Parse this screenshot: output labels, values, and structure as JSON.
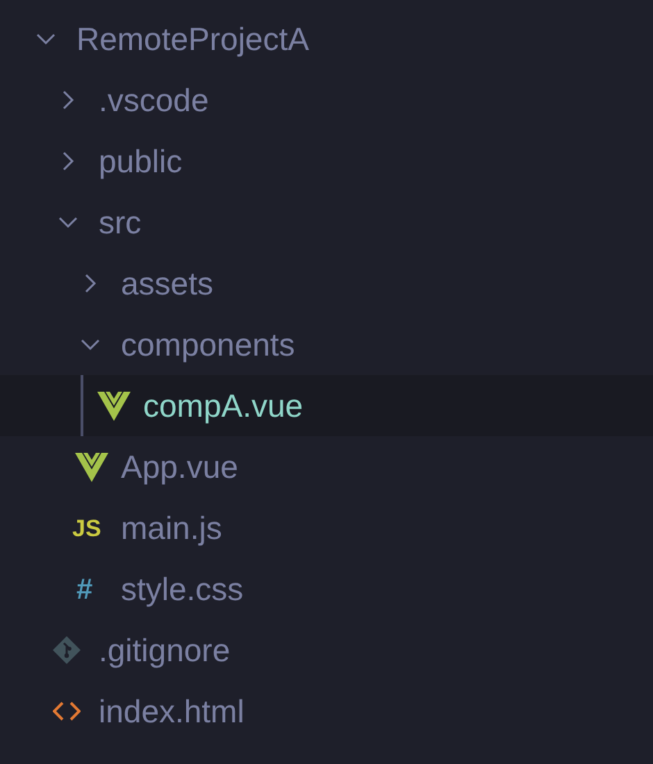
{
  "explorer": {
    "tree": [
      {
        "name": "RemoteProjectA",
        "kind": "folder",
        "expanded": true,
        "selected": false,
        "children": [
          {
            "name": ".vscode",
            "kind": "folder",
            "expanded": false,
            "selected": false
          },
          {
            "name": "public",
            "kind": "folder",
            "expanded": false,
            "selected": false
          },
          {
            "name": "src",
            "kind": "folder",
            "expanded": true,
            "selected": false,
            "children": [
              {
                "name": "assets",
                "kind": "folder",
                "expanded": false,
                "selected": false
              },
              {
                "name": "components",
                "kind": "folder",
                "expanded": true,
                "selected": false,
                "children": [
                  {
                    "name": "compA.vue",
                    "kind": "vue",
                    "selected": true
                  }
                ]
              },
              {
                "name": "App.vue",
                "kind": "vue",
                "selected": false
              },
              {
                "name": "main.js",
                "kind": "js",
                "icon": "JS",
                "selected": false
              },
              {
                "name": "style.css",
                "kind": "css",
                "icon": "#",
                "selected": false
              }
            ]
          },
          {
            "name": ".gitignore",
            "kind": "git",
            "selected": false
          },
          {
            "name": "index.html",
            "kind": "html",
            "selected": false
          }
        ]
      }
    ]
  }
}
